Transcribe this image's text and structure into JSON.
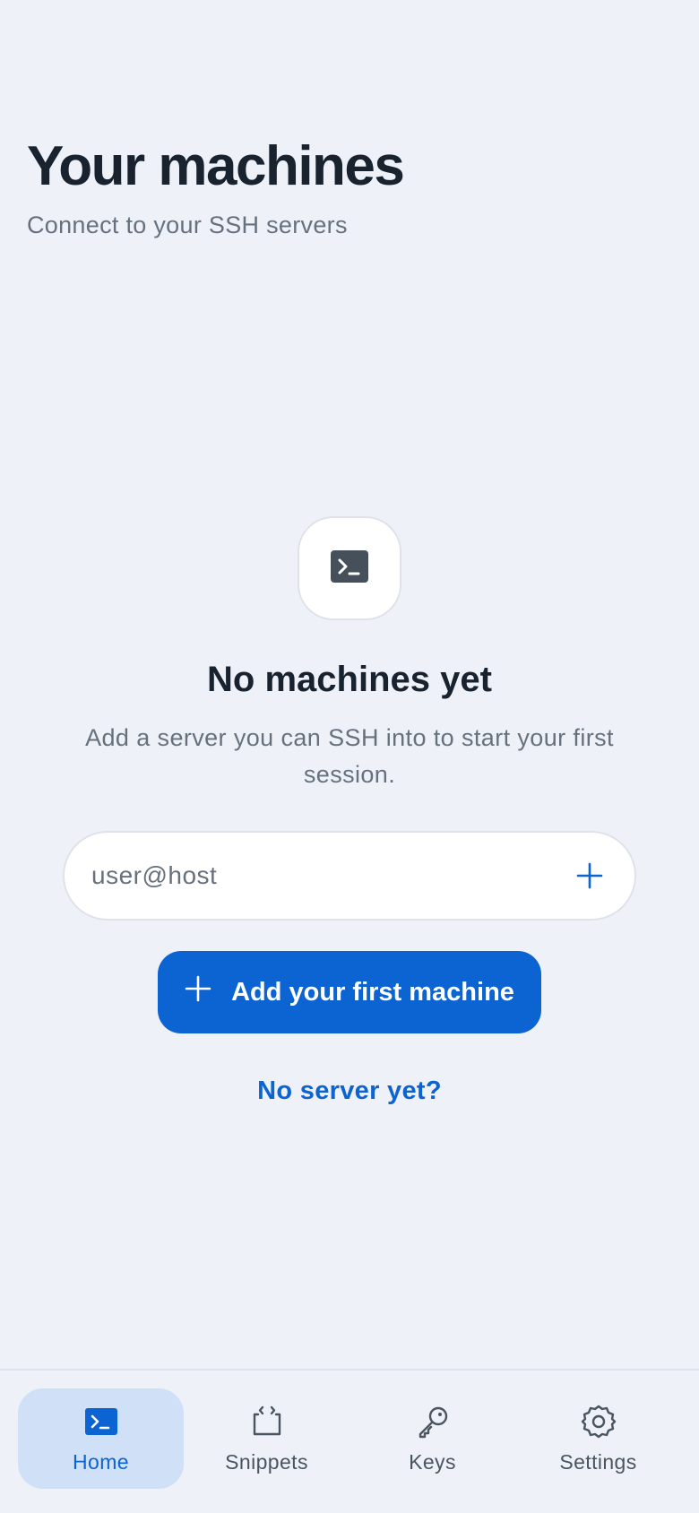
{
  "header": {
    "title": "Your machines",
    "subtitle": "Connect to your SSH servers"
  },
  "empty_state": {
    "icon": "terminal-icon",
    "title": "No machines yet",
    "description": "Add a server you can SSH into to start your first session.",
    "host_input": {
      "placeholder": "user@host",
      "value": "",
      "add_icon": "plus-icon"
    },
    "primary_button": {
      "label": "Add your first machine",
      "icon": "plus-icon"
    },
    "secondary_link": "No server yet?"
  },
  "bottom_nav": {
    "items": [
      {
        "label": "Home",
        "icon": "terminal-icon",
        "active": true
      },
      {
        "label": "Snippets",
        "icon": "code-file-icon",
        "active": false
      },
      {
        "label": "Keys",
        "icon": "key-icon",
        "active": false
      },
      {
        "label": "Settings",
        "icon": "gear-icon",
        "active": false
      }
    ]
  },
  "colors": {
    "background": "#eef2f8",
    "accent": "#0c63d2",
    "active_nav_bg": "#cfe0f7",
    "text_primary": "#18232f",
    "text_secondary": "#66717d"
  }
}
